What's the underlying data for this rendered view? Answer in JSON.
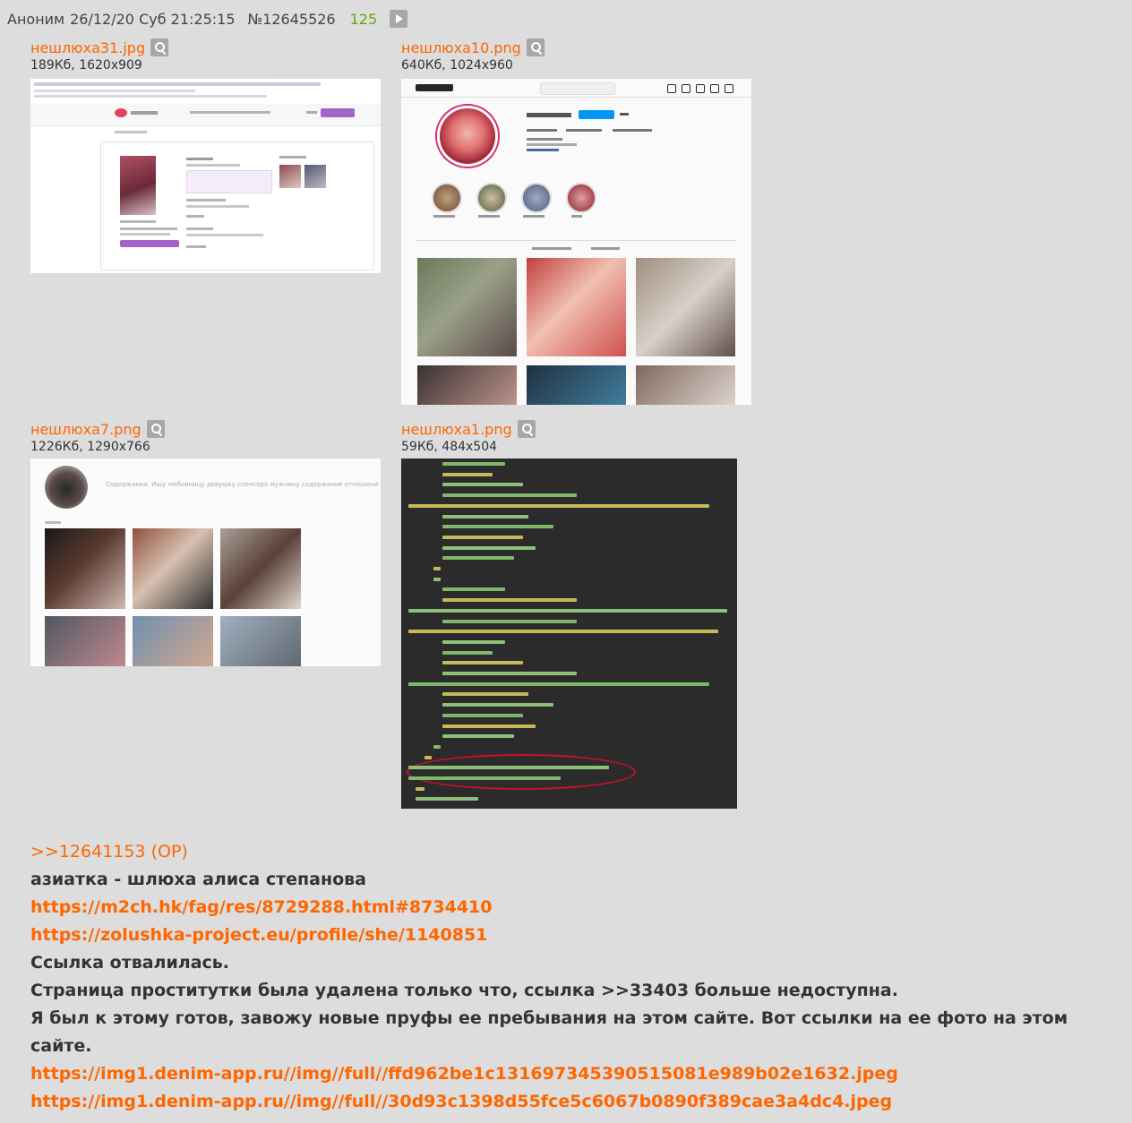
{
  "header": {
    "author": "Аноним",
    "date": "26/12/20 Суб 21:25:15",
    "post_number": "№12645526",
    "reply_count": "125"
  },
  "files": [
    {
      "name": "нешлюха31.jpg",
      "meta": "189Кб, 1620x909"
    },
    {
      "name": "нешлюха10.png",
      "meta": "640Кб, 1024x960"
    },
    {
      "name": "нешлюха7.png",
      "meta": "1226Кб, 1290x766"
    },
    {
      "name": "нешлюха1.png",
      "meta": "59Кб, 484x504"
    }
  ],
  "thumbs": {
    "profile_desc": "Содержанки. Ищу любовницу девушку спонсора мужчину содержание отношения"
  },
  "body": {
    "reply_ref": ">>12641153 (OP)",
    "line1": "азиатка - шлюха алиса степанова",
    "link1": "https://m2ch.hk/fag/res/8729288.html#8734410",
    "link2": "https://zolushka-project.eu/profile/she/1140851",
    "line2": "Ссылка отвалилась.",
    "line3": "Страница проститутки была удалена только что, ссылка >>33403 больше недоступна.",
    "line4": "Я был к этому готов, завожу новые пруфы ее пребывания на этом сайте. Вот ссылки на ее фото на этом сайте.",
    "link3": "https://img1.denim-app.ru//img//full//ffd962be1c131697345390515081e989b02e1632.jpeg",
    "link4": "https://img1.denim-app.ru//img//full//30d93c1398d55fce5c6067b0890f389cae3a4dc4.jpeg"
  },
  "colors": {
    "background": "#dddddd",
    "link": "#ff6600",
    "count": "#64a70b",
    "text": "#333333"
  }
}
